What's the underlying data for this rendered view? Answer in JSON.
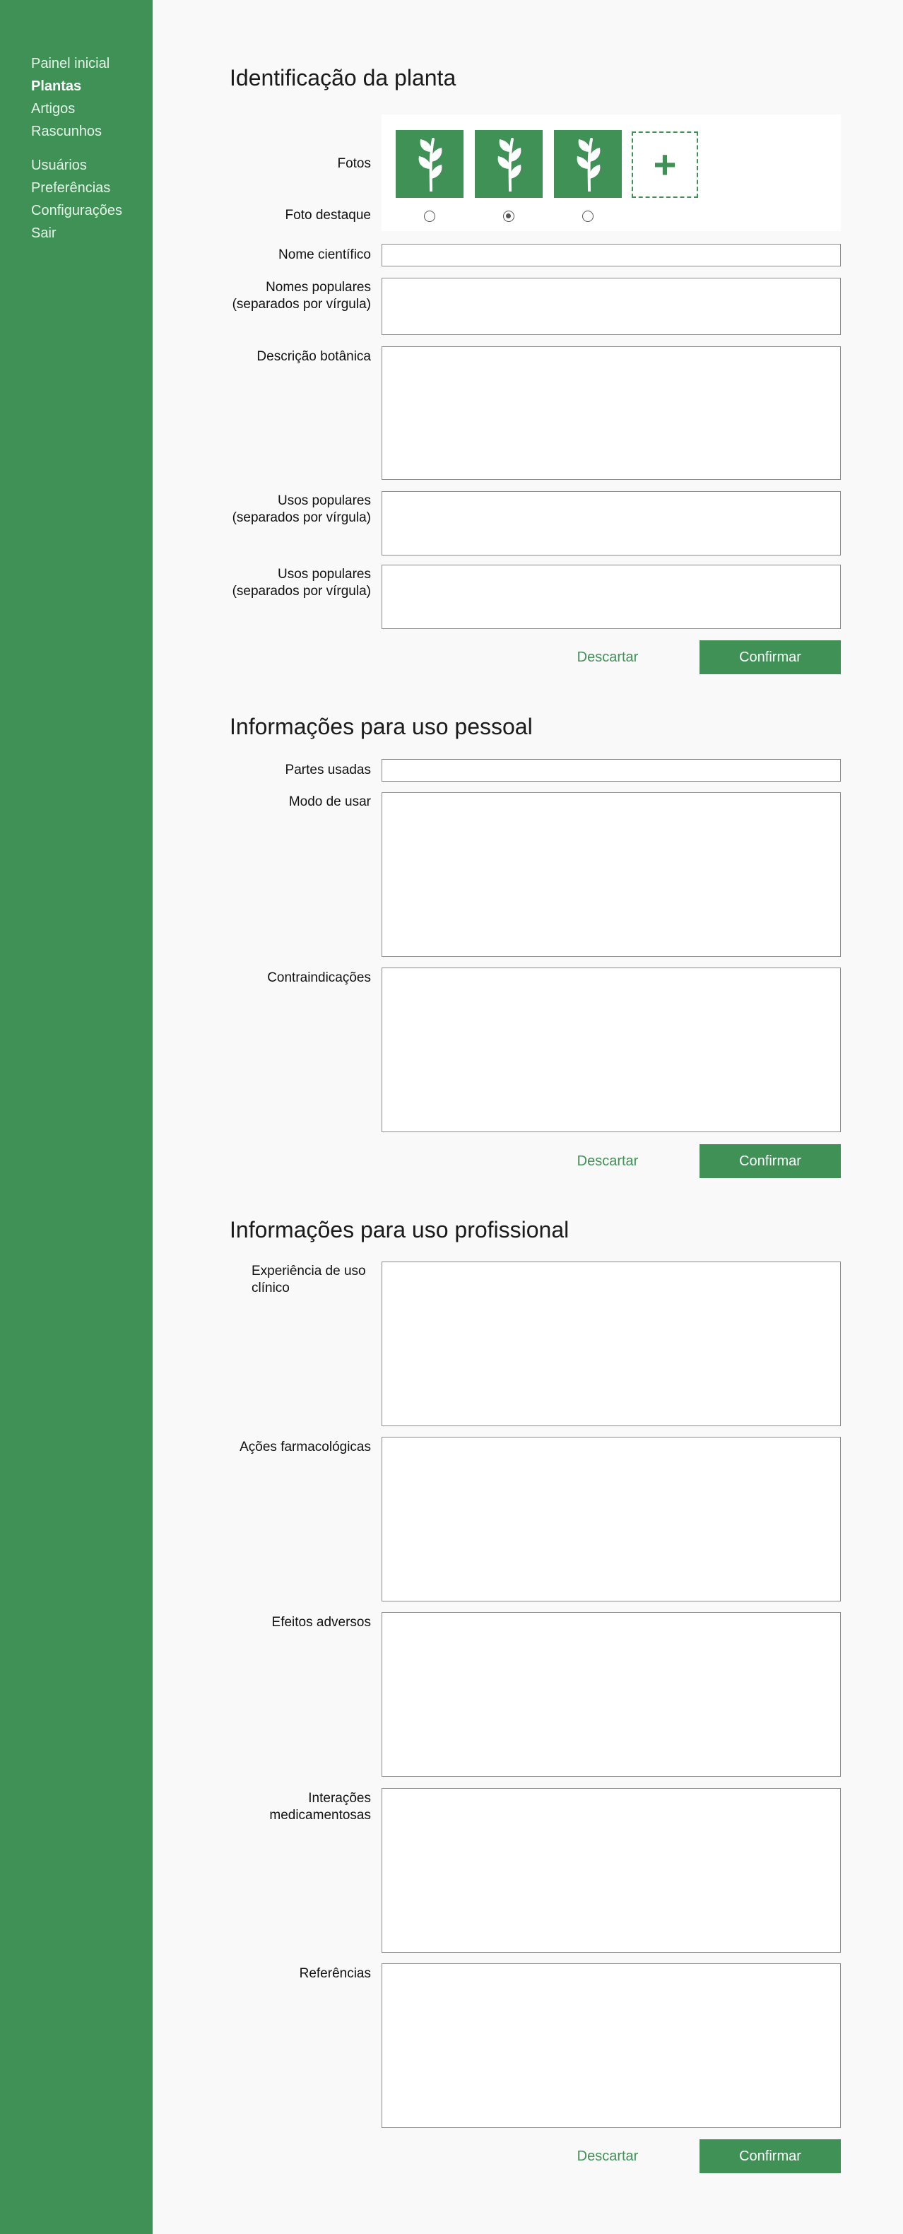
{
  "sidebar": {
    "items": [
      {
        "label": "Painel inicial"
      },
      {
        "label": "Plantas"
      },
      {
        "label": "Artigos"
      },
      {
        "label": "Rascunhos"
      },
      {
        "label": "Usuários"
      },
      {
        "label": "Preferências"
      },
      {
        "label": "Configurações"
      },
      {
        "label": "Sair"
      }
    ],
    "active": "Plantas"
  },
  "identification": {
    "title": "Identificação da planta",
    "photos_label": "Fotos",
    "featured_label": "Foto destaque",
    "photo_icons": [
      "plant-icon",
      "plant-icon",
      "plant-icon"
    ],
    "add_photo_icon": "plus-icon",
    "featured_selected_index": 1,
    "scientific_name_label": "Nome científico",
    "scientific_name_value": "",
    "popular_names_label": "Nomes populares (separados por vírgula)",
    "popular_names_value": "",
    "botanical_description_label": "Descrição botânica",
    "botanical_description_value": "",
    "popular_uses_label_1": "Usos populares (separados por vírgula)",
    "popular_uses_value_1": "",
    "popular_uses_label_2": "Usos populares (separados por vírgula)",
    "popular_uses_value_2": "",
    "discard_label": "Descartar",
    "confirm_label": "Confirmar"
  },
  "personal": {
    "title": "Informações para uso pessoal",
    "parts_used_label": "Partes usadas",
    "parts_used_value": "",
    "how_to_use_label": "Modo de usar",
    "how_to_use_value": "",
    "contraindications_label": "Contraindicações",
    "contraindications_value": "",
    "discard_label": "Descartar",
    "confirm_label": "Confirmar"
  },
  "professional": {
    "title": "Informações para uso profissional",
    "clinical_experience_label": "Experiência de uso clínico",
    "clinical_experience_value": "",
    "pharmacological_actions_label": "Ações farmacológicas",
    "pharmacological_actions_value": "",
    "adverse_effects_label": "Efeitos adversos",
    "adverse_effects_value": "",
    "drug_interactions_label": "Interações medicamentosas",
    "drug_interactions_value": "",
    "references_label": "Referências",
    "references_value": "",
    "discard_label": "Descartar",
    "confirm_label": "Confirmar"
  },
  "colors": {
    "brand_green": "#3f9156",
    "page_background": "#f9f9f9",
    "field_border": "#8a8a8a"
  }
}
